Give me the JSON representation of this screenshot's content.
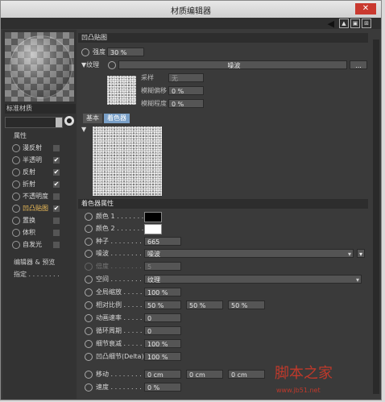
{
  "window": {
    "title": "材质编辑器",
    "close": "✕"
  },
  "left": {
    "material_name": "标准材质",
    "section_properties": "属性",
    "channels": [
      {
        "label": "漫反射",
        "checked": false
      },
      {
        "label": "半透明",
        "checked": true
      },
      {
        "label": "反射",
        "checked": true
      },
      {
        "label": "折射",
        "checked": true
      },
      {
        "label": "不透明度",
        "checked": false
      },
      {
        "label": "凹凸贴图",
        "checked": true,
        "active": true
      },
      {
        "label": "置换",
        "checked": false
      },
      {
        "label": "体积",
        "checked": false
      },
      {
        "label": "自发光",
        "checked": false
      }
    ],
    "editor_preview": "编辑器 & 预览",
    "assign": "指定 . . . . . . . ."
  },
  "bump": {
    "header": "凹凸贴图",
    "strength_label": "强度",
    "strength_value": "30 %",
    "texture_label": "纹理",
    "texture_value": "噪波",
    "texture_btn": "...",
    "sampling_label": "采样",
    "sampling_value": "无",
    "blur_offset_label": "模糊偏移",
    "blur_offset_value": "0 %",
    "blur_scale_label": "模糊程度",
    "blur_scale_value": "0 %",
    "tab_basic": "基本",
    "tab_shader": "着色器"
  },
  "shader": {
    "header": "着色器属性",
    "color1_label": "颜色 1 . . . . . . .",
    "color1": "#000000",
    "color2_label": "颜色 2 . . . . . . .",
    "color2": "#ffffff",
    "seed_label": "种子 . . . . . . . .",
    "seed_value": "665",
    "noise_label": "噪波 . . . . . . . .",
    "noise_value": "噪波",
    "octaves_label": "倍度 . . . . . . . .",
    "octaves_value": "5",
    "space_label": "空间 . . . . . . . .",
    "space_value": "纹理",
    "global_scale_label": "全局缩放 . . . . .",
    "global_scale_value": "100 %",
    "rel_scale_label": "相对比例 . . . . .",
    "rel_scale_values": [
      "50 %",
      "50 %",
      "50 %"
    ],
    "anim_speed_label": "动画速率 . . . . .",
    "anim_speed_value": "0",
    "loop_period_label": "循环周期 . . . . .",
    "loop_period_value": "0",
    "detail_att_label": "细节衰减 . . . . .",
    "detail_att_value": "100 %",
    "delta_label": "凹凸细节(Delta)",
    "delta_value": "100 %",
    "move_label": "移动 . . . . . . . .",
    "move_values": [
      "0 cm",
      "0 cm",
      "0 cm"
    ],
    "speed_label": "速度 . . . . . . . .",
    "speed_value": "0 %"
  },
  "watermark": {
    "text": "脚本之家",
    "url": "www.jb51.net"
  }
}
